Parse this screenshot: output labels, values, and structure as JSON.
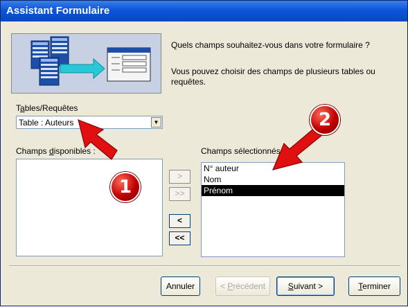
{
  "window": {
    "title": "Assistant Formulaire"
  },
  "intro": {
    "question": "Quels champs souhaitez-vous dans votre formulaire ?",
    "hint": "Vous pouvez choisir des champs de plusieurs tables ou requêtes."
  },
  "tables": {
    "label_prefix": "T",
    "label_mnemonic": "a",
    "label_rest": "bles/Requêtes",
    "selected": "Table : Auteurs"
  },
  "available": {
    "label_prefix": "Champs ",
    "label_mnemonic": "d",
    "label_rest": "isponibles :",
    "items": []
  },
  "selected_fields": {
    "label": "Champs sélectionnés :",
    "items": [
      "N° auteur",
      "Nom",
      "Prénom"
    ],
    "highlighted": "Prénom"
  },
  "move_buttons": {
    "add_one": ">",
    "add_all": ">>",
    "remove_one": "<",
    "remove_all": "<<"
  },
  "footer": {
    "cancel": "Annuler",
    "back_prefix": "< ",
    "back_mnemonic": "P",
    "back_rest": "récédent",
    "next_mnemonic": "S",
    "next_rest": "uivant >",
    "finish_mnemonic": "T",
    "finish_rest": "erminer"
  },
  "annotations": {
    "badge1": "1",
    "badge2": "2",
    "arrow_color": "#e01010"
  }
}
